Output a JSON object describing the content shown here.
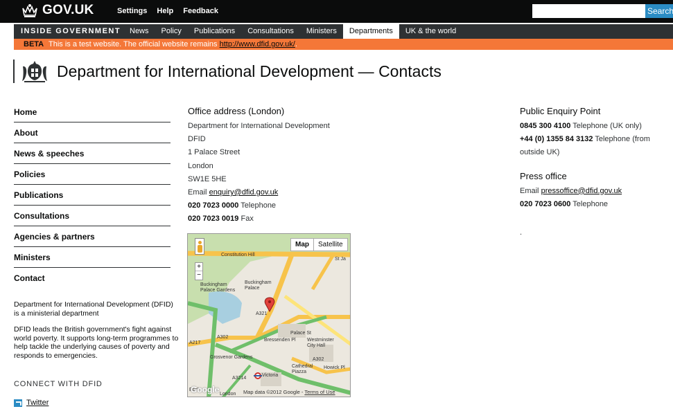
{
  "header": {
    "logo_text": "GOV.UK",
    "links": [
      "Settings",
      "Help",
      "Feedback"
    ],
    "search_placeholder": "",
    "search_button": "Search"
  },
  "section_nav": {
    "title": "INSIDE GOVERNMENT",
    "items": [
      "News",
      "Policy",
      "Publications",
      "Consultations",
      "Ministers",
      "Departments",
      "UK & the world"
    ],
    "active": "Departments"
  },
  "beta": {
    "tag": "BETA",
    "text": "This is a test website. The official website remains",
    "link": "http://www.dfid.gov.uk/",
    "suffix": "."
  },
  "page": {
    "title": "Department for International Development — Contacts"
  },
  "left_nav": {
    "items": [
      "Home",
      "About",
      "News & speeches",
      "Policies",
      "Publications",
      "Consultations",
      "Agencies & partners",
      "Ministers",
      "Contact"
    ],
    "desc1": "Department for International Development (DFID) is a ministerial department",
    "desc2": "DFID leads the British government's fight against world poverty. It supports long-term programmes to help tackle the underlying causes of poverty and responds to emergencies.",
    "connect": "CONNECT WITH DFID",
    "twitter": "Twitter"
  },
  "office": {
    "heading": "Office address (London)",
    "lines": [
      "Department for International Development",
      "DFID",
      "1 Palace Street",
      "London",
      "SW1E 5HE"
    ],
    "email_label": "Email",
    "email": "enquiry@dfid.gov.uk",
    "phone": "020 7023 0000",
    "phone_label": "Telephone",
    "fax": "020 7023 0019",
    "fax_label": "Fax"
  },
  "map": {
    "toggle": [
      "Map",
      "Satellite"
    ],
    "zoom": [
      "+",
      "−"
    ],
    "labels": [
      "Constitution Hill",
      "St Ja",
      "Buckingham Palace Gardens",
      "Buckingham Palace",
      "A321",
      "A302",
      "A217",
      "Grosvenor Gardens",
      "Bressenden Pl",
      "Palace St",
      "Westminster City Hall",
      "A302",
      "Cathedral Piazza",
      "Howick Pl",
      "Victoria",
      "A3214",
      "London",
      "Eccl"
    ],
    "attribution": "Map data ©2012 Google -",
    "terms": "Terms of Use",
    "logo": "Google"
  },
  "public_enquiry": {
    "heading": "Public Enquiry Point",
    "phone1": "0845 300 4100",
    "phone1_label": "Telephone (UK only)",
    "phone2": "+44 (0) 1355 84 3132",
    "phone2_label": "Telephone (from outside UK)"
  },
  "press_office": {
    "heading": "Press office",
    "email_label": "Email",
    "email": "pressoffice@dfid.gov.uk",
    "phone": "020 7023 0600",
    "phone_label": "Telephone",
    "dot": "."
  },
  "colors": {
    "black": "#0b0c0c",
    "nav_grey": "#2e3133",
    "beta_orange": "#f47738",
    "search_blue": "#2b8cc4"
  }
}
